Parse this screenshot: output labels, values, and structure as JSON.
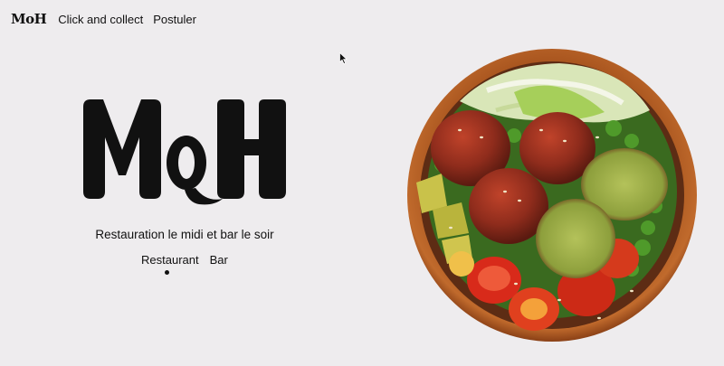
{
  "nav": {
    "logo": "MoH",
    "links": [
      "Click and collect",
      "Postuler"
    ]
  },
  "hero": {
    "logo_text": "MoH",
    "tagline": "Restauration le midi et bar le soir",
    "tabs": [
      "Restaurant",
      "Bar"
    ],
    "active_tab": "Restaurant"
  },
  "image": {
    "subject": "falafel-bowl"
  },
  "colors": {
    "background": "#eeecee",
    "text": "#111111",
    "bowl": "#b35a22"
  }
}
